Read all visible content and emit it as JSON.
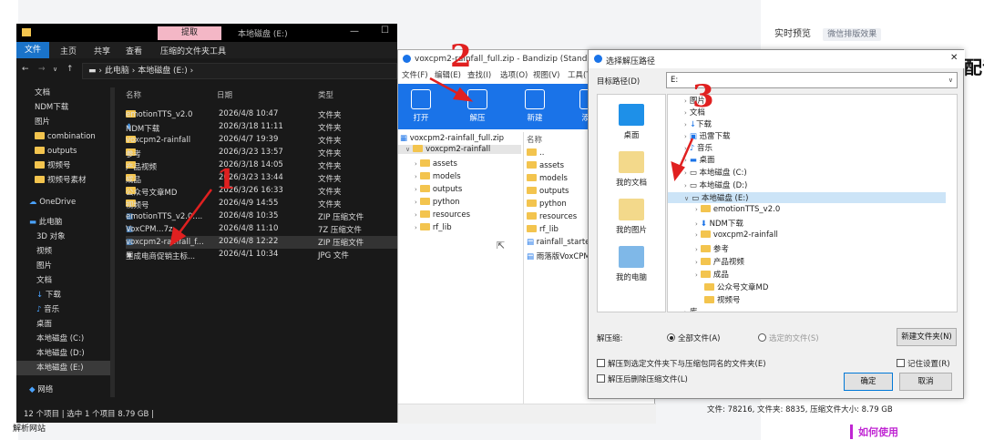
{
  "background": {
    "tabs": [
      "实时预览",
      "微信排版效果"
    ],
    "heading": "配音",
    "left_bottom": "解析网站",
    "howto": "如何使用"
  },
  "explorer": {
    "context_tab": "提取",
    "title": "本地磁盘 (E:)",
    "menu": [
      "文件",
      "主页",
      "共享",
      "查看",
      "压缩的文件夹工具"
    ],
    "address": [
      "此电脑",
      "本地磁盘 (E:)"
    ],
    "nav": [
      "文档",
      "NDM下载",
      "图片",
      "combination",
      "outputs",
      "视频号",
      "视频号素材",
      "OneDrive",
      "此电脑",
      "3D 对象",
      "视频",
      "图片",
      "文档",
      "下载",
      "音乐",
      "桌面",
      "本地磁盘 (C:)",
      "本地磁盘 (D:)",
      "本地磁盘 (E:)",
      "网络"
    ],
    "columns": [
      "名称",
      "日期",
      "类型"
    ],
    "rows": [
      {
        "name": "emotionTTS_v2.0",
        "date": "2026/4/8 10:47",
        "type": "文件夹"
      },
      {
        "name": "NDM下载",
        "date": "2026/3/18 11:11",
        "type": "文件夹"
      },
      {
        "name": "voxcpm2-rainfall",
        "date": "2026/4/7 19:39",
        "type": "文件夹"
      },
      {
        "name": "参考",
        "date": "2026/3/23 13:57",
        "type": "文件夹"
      },
      {
        "name": "产品视频",
        "date": "2026/3/18 14:05",
        "type": "文件夹"
      },
      {
        "name": "成品",
        "date": "2026/3/23 13:44",
        "type": "文件夹"
      },
      {
        "name": "公众号文章MD",
        "date": "2026/3/26 16:33",
        "type": "文件夹"
      },
      {
        "name": "视频号",
        "date": "2026/4/9 14:55",
        "type": "文件夹"
      },
      {
        "name": "emotionTTS_v2.0....",
        "date": "2026/4/8 10:35",
        "type": "ZIP 压缩文件"
      },
      {
        "name": "VoxCPM...7z",
        "date": "2026/4/8 11:10",
        "type": "7Z 压缩文件"
      },
      {
        "name": "voxcpm2-rainfall_f...",
        "date": "2026/4/8 12:22",
        "type": "ZIP 压缩文件"
      },
      {
        "name": "生成电商促销主标...",
        "date": "2026/4/1 10:34",
        "type": "JPG 文件"
      }
    ],
    "status": "12 个项目  |  选中 1 个项目  8.79 GB  |"
  },
  "bandizip": {
    "title": "voxcpm2-rainfall_full.zip - Bandizip (Standard)",
    "menu": [
      "文件(F)",
      "编辑(E)",
      "查找(I)",
      "选项(O)",
      "视图(V)",
      "工具(T)"
    ],
    "tools": [
      "打开",
      "解压",
      "新建",
      "添加"
    ],
    "tree": [
      "voxcpm2-rainfall_full.zip",
      "voxcpm2-rainfall",
      "assets",
      "models",
      "outputs",
      "python",
      "resources",
      "rf_lib"
    ],
    "list_header": "名称",
    "list": [
      "..",
      "assets",
      "models",
      "outputs",
      "python",
      "resources",
      "rf_lib",
      "rainfall_starter",
      "雨落版VoxCPM"
    ]
  },
  "dialog": {
    "title": "选择解压路径",
    "path_label": "目标路径(D)",
    "path_value": "E:",
    "places": [
      "桌面",
      "我的文档",
      "我的图片",
      "我的电脑"
    ],
    "tree": [
      "图片",
      "文档",
      "下载",
      "迅雷下载",
      "音乐",
      "桌面",
      "本地磁盘 (C:)",
      "本地磁盘 (D:)",
      "本地磁盘 (E:)",
      "emotionTTS_v2.0",
      "NDM下载",
      "voxcpm2-rainfall",
      "参考",
      "产品视频",
      "成品",
      "公众号文章MD",
      "视频号",
      "库"
    ],
    "extract_label": "解压缩:",
    "opt_all": "全部文件(A)",
    "opt_sel": "选定的文件(S)",
    "newfolder": "新建文件夹(N)",
    "chk1": "解压到选定文件夹下与压缩包同名的文件夹(E)",
    "chk2": "解压后删除压缩文件(L)",
    "chk3": "记住设置(R)",
    "ok": "确定",
    "cancel": "取消",
    "status": "文件: 78216, 文件夹: 8835, 压缩文件大小: 8.79 GB"
  },
  "annotations": [
    "1",
    "2",
    "3"
  ]
}
